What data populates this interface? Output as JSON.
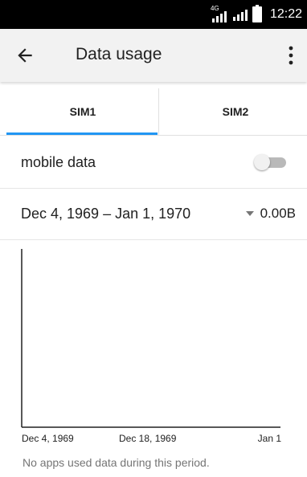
{
  "status_bar": {
    "network_type": "4G",
    "time": "12:22"
  },
  "app_bar": {
    "title": "Data usage",
    "back_icon": "arrow-back-icon",
    "menu_icon": "more-vert-icon"
  },
  "tabs": [
    {
      "label": "SIM1",
      "selected": true
    },
    {
      "label": "SIM2",
      "selected": false
    }
  ],
  "accent_color": "#2196f3",
  "mobile_data": {
    "label": "mobile data",
    "enabled": false
  },
  "cycle": {
    "range": "Dec 4, 1969 – Jan 1, 1970",
    "usage": "0.00B"
  },
  "chart_data": {
    "type": "line",
    "x_tick_labels": [
      "Dec 4, 1969",
      "Dec 18, 1969",
      "Jan 1"
    ],
    "series": []
  },
  "empty_message": "No apps used data during this period."
}
